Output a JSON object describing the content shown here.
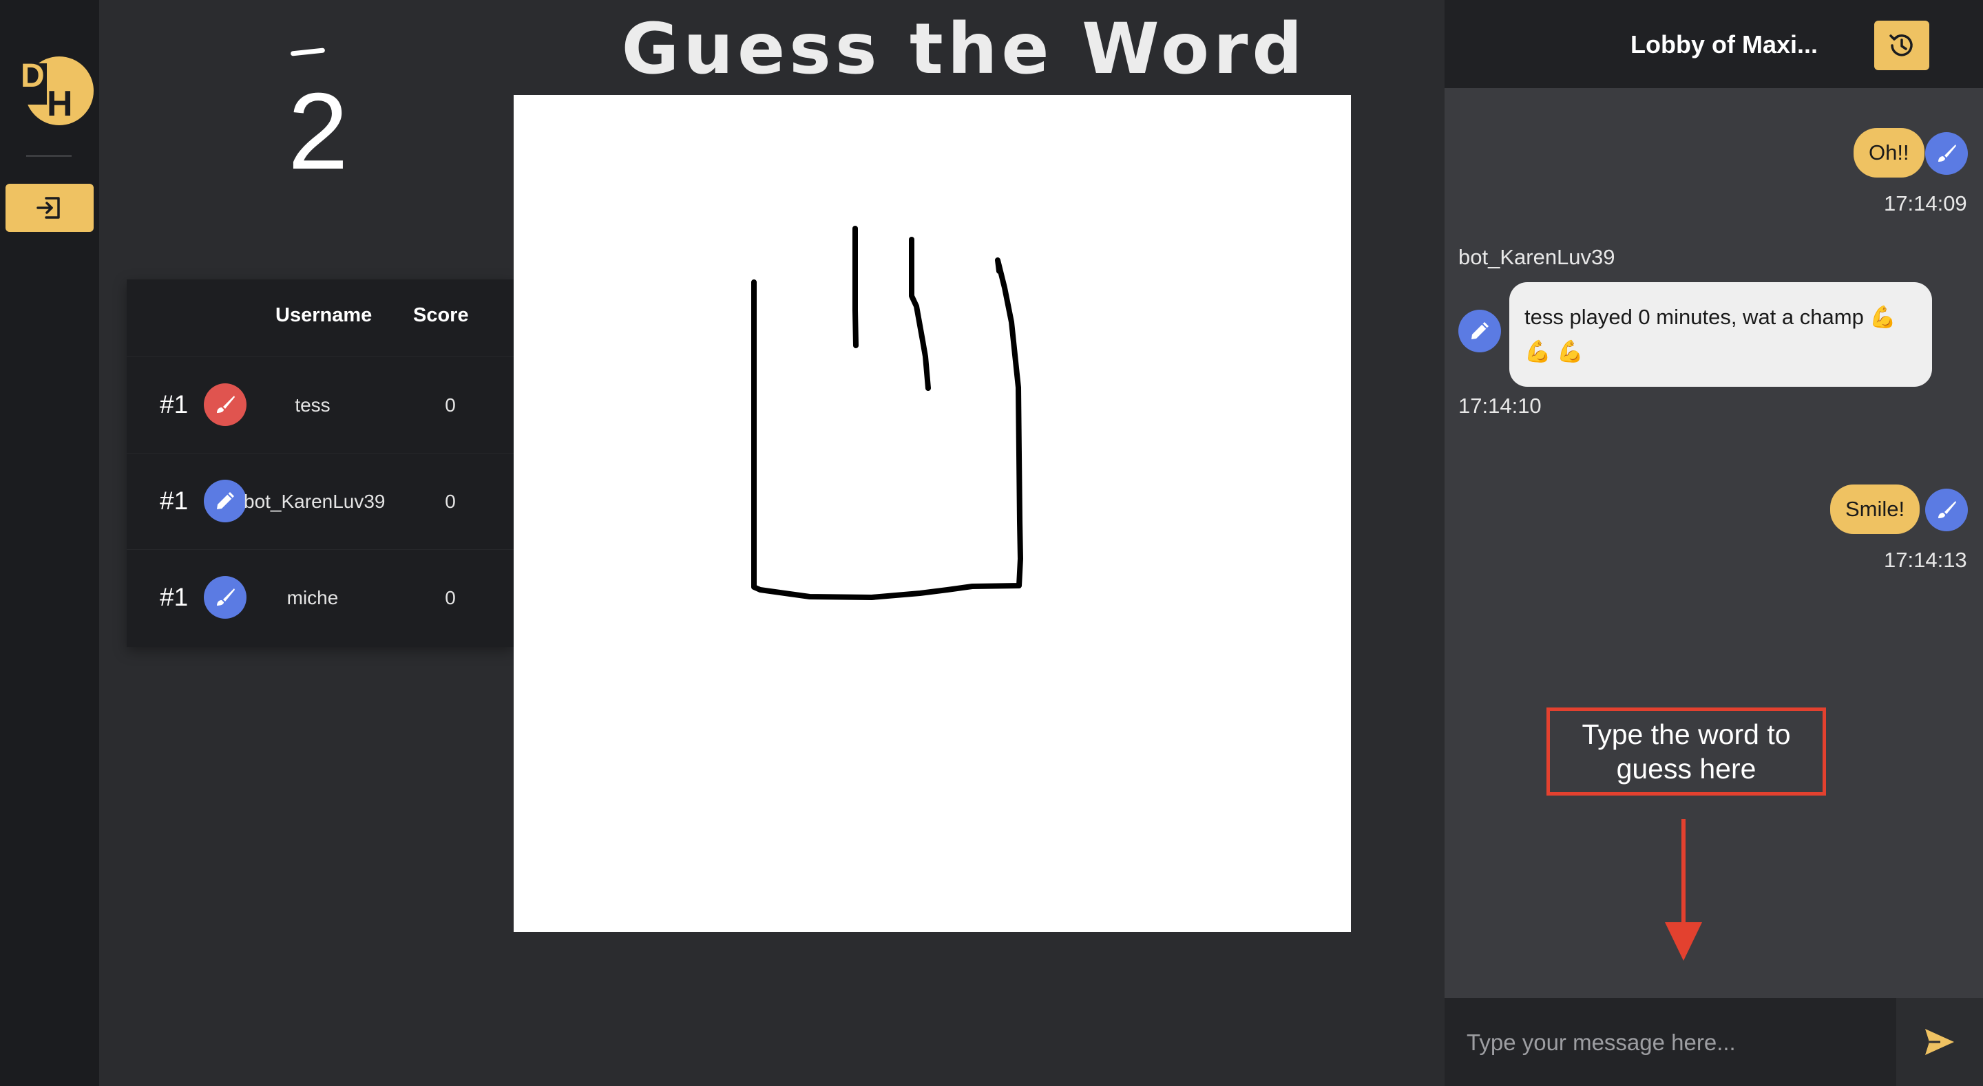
{
  "app": {
    "title": "Guess the Word",
    "timer": "2",
    "logo_letters": [
      "D",
      "H"
    ],
    "accent": "#efc262"
  },
  "scoreboard": {
    "headers": {
      "username": "Username",
      "score": "Score"
    },
    "rows": [
      {
        "rank": "#1",
        "username": "tess",
        "score": "0",
        "role_icon": "brush-icon",
        "avatar_color": "#e0544f"
      },
      {
        "rank": "#1",
        "username": "bot_KarenLuv39",
        "score": "0",
        "role_icon": "pencil-icon",
        "avatar_color": "#5b7be3"
      },
      {
        "rank": "#1",
        "username": "miche",
        "score": "0",
        "role_icon": "brush-icon",
        "avatar_color": "#5b7be3"
      }
    ]
  },
  "chat": {
    "lobby_title": "Lobby of Maxi...",
    "messages": [
      {
        "text": "Oh!!",
        "time": "17:14:09",
        "own": true
      },
      {
        "sender": "bot_KarenLuv39",
        "text": "tess played 0 minutes, wat a champ 💪 💪 💪",
        "time": "17:14:10",
        "own": false
      },
      {
        "text": "Smile!",
        "time": "17:14:13",
        "own": true
      }
    ],
    "annotation": "Type the word to guess here",
    "input_placeholder": "Type your message here..."
  },
  "icons": {
    "exit": "exit-icon",
    "history": "history-icon",
    "send": "send-icon"
  }
}
